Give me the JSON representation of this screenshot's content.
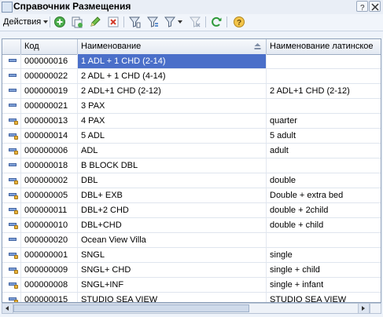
{
  "window": {
    "title": "Справочник Размещения"
  },
  "toolbar": {
    "actions_label": "Действия"
  },
  "table": {
    "columns": {
      "code": "Код",
      "name": "Наименование",
      "latin": "Наименование латинское"
    },
    "rows": [
      {
        "code": "000000016",
        "name": "1 ADL + 1 CHD (2-14)",
        "latin": "",
        "icon": "item-icon",
        "selected": true
      },
      {
        "code": "000000022",
        "name": "2 ADL + 1 CHD (4-14)",
        "latin": "",
        "icon": "item-icon"
      },
      {
        "code": "000000019",
        "name": "2 ADL+1 CHD (2-12)",
        "latin": "2 ADL+1 CHD (2-12)",
        "icon": "item-icon"
      },
      {
        "code": "000000021",
        "name": "3 PAX",
        "latin": "",
        "icon": "item-icon"
      },
      {
        "code": "000000013",
        "name": "4 PAX",
        "latin": "quarter",
        "icon": "item-marked-icon"
      },
      {
        "code": "000000014",
        "name": "5 ADL",
        "latin": "5 adult",
        "icon": "item-marked-icon"
      },
      {
        "code": "000000006",
        "name": "ADL",
        "latin": "adult",
        "icon": "item-marked-icon"
      },
      {
        "code": "000000018",
        "name": "B BLOCK DBL",
        "latin": "",
        "icon": "item-icon"
      },
      {
        "code": "000000002",
        "name": "DBL",
        "latin": "double",
        "icon": "item-marked-icon"
      },
      {
        "code": "000000005",
        "name": "DBL+ EXB",
        "latin": "Double + extra bed",
        "icon": "item-marked-icon"
      },
      {
        "code": "000000011",
        "name": "DBL+2 CHD",
        "latin": "double + 2child",
        "icon": "item-marked-icon"
      },
      {
        "code": "000000010",
        "name": "DBL+CHD",
        "latin": "double + child",
        "icon": "item-marked-icon"
      },
      {
        "code": "000000020",
        "name": "Ocean View Villa",
        "latin": "",
        "icon": "item-icon"
      },
      {
        "code": "000000001",
        "name": "SNGL",
        "latin": "single",
        "icon": "item-marked-icon"
      },
      {
        "code": "000000009",
        "name": "SNGL+ CHD",
        "latin": "single + child",
        "icon": "item-marked-icon"
      },
      {
        "code": "000000008",
        "name": "SNGL+INF",
        "latin": "single + infant",
        "icon": "item-marked-icon"
      },
      {
        "code": "000000015",
        "name": "STUDIO SEA VIEW",
        "latin": "STUDIO SEA VIEW",
        "icon": "item-marked-icon"
      }
    ]
  },
  "colors": {
    "selection": "#4a6fc9",
    "header": "#e3e9f2"
  }
}
